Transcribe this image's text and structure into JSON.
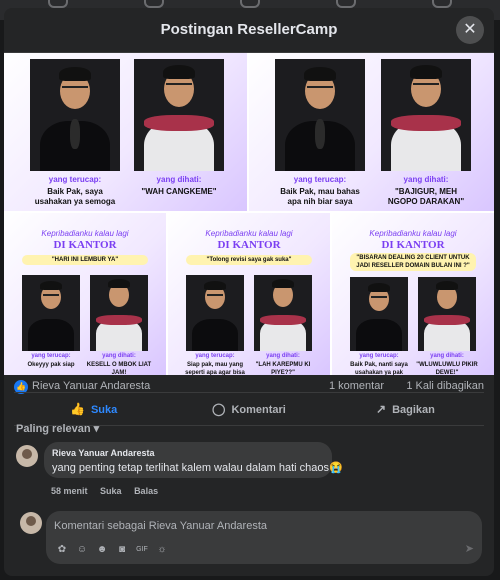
{
  "modal": {
    "title": "Postingan ResellerCamp",
    "close_glyph": "✕"
  },
  "image": {
    "top": [
      {
        "label": "yang terucap:",
        "text": "Baik Pak, saya usahakan ya semoga",
        "label2": "yang dihati:",
        "text2": "\"WAH CANGKEME\""
      },
      {
        "label": "yang terucap:",
        "text": "Baik Pak, mau bahas apa nih biar saya",
        "label2": "yang dihati:",
        "text2": "\"BAJIGUR, MEH NGOPO DARAKAN\""
      }
    ],
    "bottom": [
      {
        "kicker": "Kepribadianku kalau lagi",
        "heading": "DI KANTOR",
        "pill": "\"HARI INI LEMBUR YA\"",
        "label": "yang terucap:",
        "text": "Okeyyy pak siap",
        "label2": "yang dihati:",
        "text2": "KESELL O MBOK LIAT JAM!"
      },
      {
        "kicker": "Kepribadianku kalau lagi",
        "heading": "DI KANTOR",
        "pill": "\"Tolong revisi saya gak suka\"",
        "label": "yang terucap:",
        "text": "Siap pak, mau yang seperti apa agar bisa",
        "label2": "yang dihati:",
        "text2": "\"LAH KAREPMU KI PIYE??\""
      },
      {
        "kicker": "Kepribadianku kalau lagi",
        "heading": "DI KANTOR",
        "pill": "\"BISARAN DEALING 20 CLIENT UNTUK JADI RESELLER DOMAIN BULAN INI ?\"",
        "label": "yang terucap:",
        "text": "Baik Pak, nanti saya usahakan ya pak",
        "label2": "yang dihati:",
        "text2": "\"WLUWLUWLU PIKIR DEWE!\""
      }
    ]
  },
  "stats": {
    "liker": "Rieva Yanuar Andaresta",
    "comments": "1 komentar",
    "shares": "1 Kali dibagikan"
  },
  "actions": {
    "like": "Suka",
    "comment": "Komentari",
    "share": "Bagikan"
  },
  "sort": {
    "label": "Paling relevan",
    "chevron": "▾"
  },
  "comment": {
    "author": "Rieva Yanuar Andaresta",
    "text": "yang penting tetap terlihat kalem walau dalam hati chaos😭",
    "time": "58 menit",
    "like": "Suka",
    "reply": "Balas"
  },
  "composer": {
    "placeholder": "Komentari sebagai Rieva Yanuar Andaresta"
  },
  "colors": {
    "accent": "#2e89ff",
    "purple": "#7b3ff2",
    "surface": "#242526"
  },
  "icons": [
    "thumb-up-icon",
    "comment-bubble-icon",
    "share-icon",
    "sticker-icon",
    "avatar-icon",
    "emoji-icon",
    "camera-icon",
    "gif-icon",
    "sticker-smile-icon",
    "send-icon"
  ]
}
